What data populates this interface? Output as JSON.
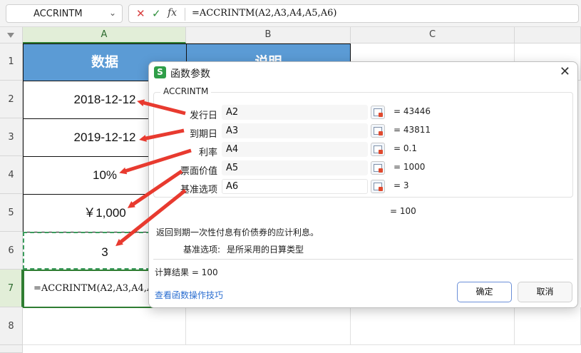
{
  "formula_bar": {
    "name_box": "ACCRINTM",
    "name_box_arrow": "⌄",
    "cancel_icon": "✕",
    "confirm_icon": "✓",
    "fx_label": "fx",
    "formula": "=ACCRINTM(A2,A3,A4,A5,A6)"
  },
  "corner_icon": "select-all-triangle",
  "columns": [
    "A",
    "B",
    "C"
  ],
  "rows": [
    "1",
    "2",
    "3",
    "4",
    "5",
    "6",
    "7",
    "8"
  ],
  "sheet": {
    "header_a": "数据",
    "header_b": "说明",
    "a2": "2018-12-12",
    "a3": "2019-12-12",
    "a4": "10%",
    "a5": "￥1,000",
    "a6": "3",
    "a7": "=ACCRINTM(A2,A3,A4,A5"
  },
  "dialog": {
    "logo": "S",
    "title": "函数参数",
    "close_icon": "✕",
    "function_name": "ACCRINTM",
    "args": [
      {
        "label": "发行日",
        "value": "A2",
        "result": "=  43446"
      },
      {
        "label": "到期日",
        "value": "A3",
        "result": "=  43811"
      },
      {
        "label": "利率",
        "value": "A4",
        "result": "=  0.1"
      },
      {
        "label": "票面价值",
        "value": "A5",
        "result": "=  1000"
      },
      {
        "label": "基准选项",
        "value": "A6",
        "result": "=  3"
      }
    ],
    "total": "=  100",
    "description": "返回到期一次性付息有价债券的应计利息。",
    "param_label": "基准选项:",
    "param_text": "是所采用的日算类型",
    "result": "计算结果  =  100",
    "help_link": "查看函数操作技巧",
    "ok_label": "确定",
    "cancel_label": "取消"
  },
  "colors": {
    "header_fill": "#5b9bd5",
    "selection_green": "#2f7d32",
    "annotation_red": "#e83a2f",
    "link_blue": "#2c6fd1"
  }
}
